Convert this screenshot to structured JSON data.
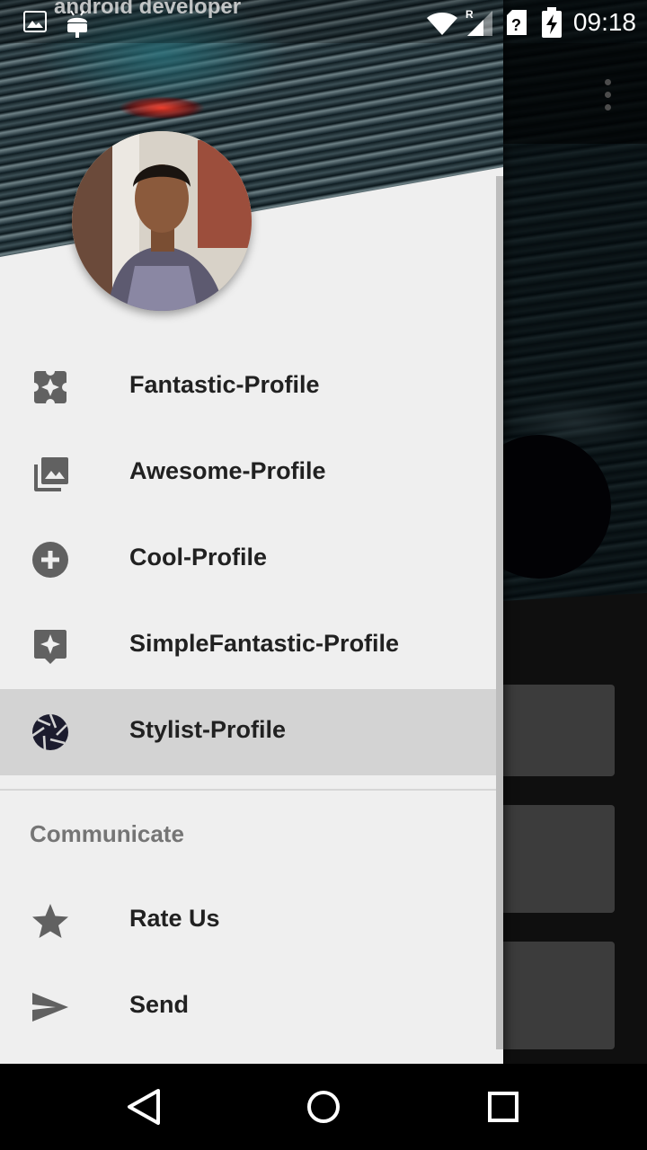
{
  "status_bar": {
    "time": "09:18",
    "notification_text": "android developer",
    "icons": [
      "image-icon",
      "android-icon",
      "wifi-icon",
      "signal-roaming-icon",
      "unknown-sim-icon",
      "battery-charging-icon"
    ]
  },
  "background_app": {
    "overflow_icon": "more-vert-icon",
    "colors": {
      "card": "#6e6e6e",
      "circle": "#04040a"
    }
  },
  "drawer": {
    "header": {
      "avatar": "profile-photo"
    },
    "items": [
      {
        "label": "Fantastic-Profile",
        "icon": "puzzle-icon",
        "selected": false
      },
      {
        "label": "Awesome-Profile",
        "icon": "photo-library-icon",
        "selected": false
      },
      {
        "label": "Cool-Profile",
        "icon": "add-circle-icon",
        "selected": false
      },
      {
        "label": "SimpleFantastic-Profile",
        "icon": "sparkle-badge-icon",
        "selected": false
      },
      {
        "label": "Stylist-Profile",
        "icon": "camera-shutter-icon",
        "selected": true
      }
    ],
    "section": {
      "title": "Communicate",
      "items": [
        {
          "label": "Rate Us",
          "icon": "star-icon"
        },
        {
          "label": "Send",
          "icon": "send-icon"
        }
      ]
    },
    "colors": {
      "background": "#efefef",
      "selected": "#d3d3d3",
      "icon": "#616161",
      "text": "#212121",
      "section_title": "#757575"
    }
  },
  "nav_bar": {
    "back_icon": "back-triangle-icon",
    "home_icon": "home-circle-icon",
    "recents_icon": "recents-square-icon"
  }
}
